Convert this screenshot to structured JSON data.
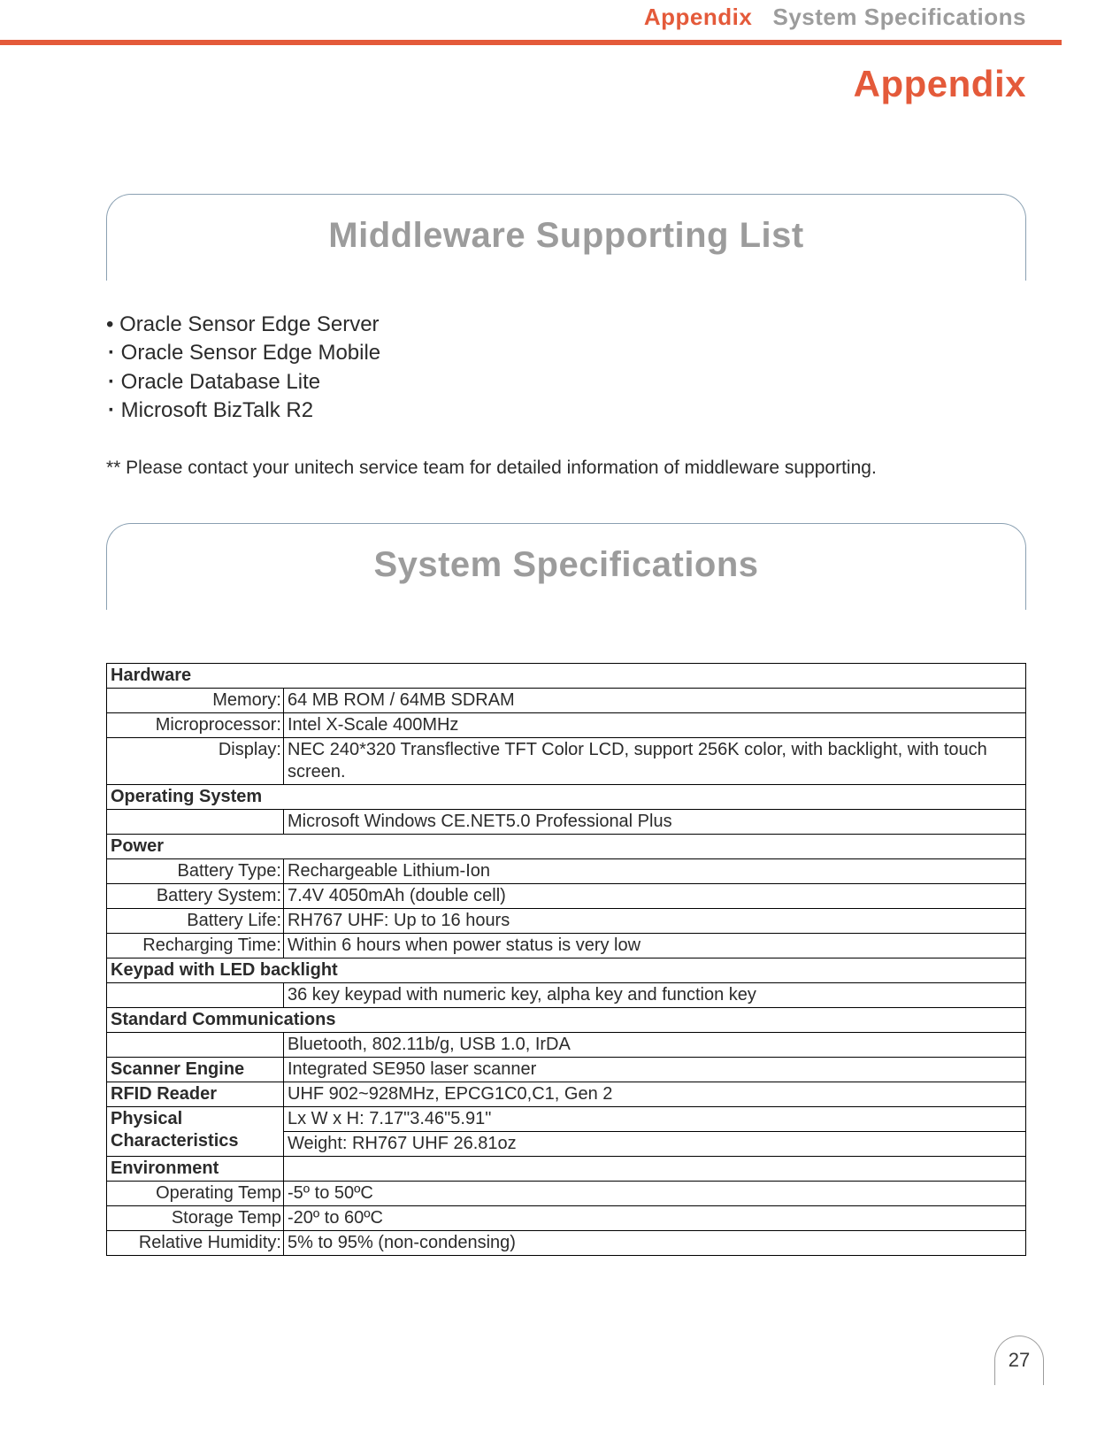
{
  "header": {
    "bc_accent": "Appendix",
    "bc_grey": "System Specifications"
  },
  "page_title": "Appendix",
  "middleware": {
    "banner": "Middleware Supporting List",
    "items": [
      "Oracle Sensor Edge Server",
      "Oracle Sensor Edge Mobile",
      "Oracle Database Lite",
      "Microsoft BizTalk R2"
    ],
    "footnote": "** Please contact your unitech service team for detailed information of middleware supporting."
  },
  "sysspec": {
    "banner": "System Specifications"
  },
  "spec": {
    "hardware_hdr": "Hardware",
    "memory_l": "Memory:",
    "memory_v": "64 MB ROM / 64MB SDRAM",
    "micro_l": "Microprocessor:",
    "micro_v": "Intel X-Scale 400MHz",
    "display_l": "Display:",
    "display_v": "NEC 240*320 Transflective TFT Color LCD, support 256K color, with backlight, with touch screen.",
    "os_hdr": "Operating System",
    "os_v": "Microsoft Windows CE.NET5.0 Professional Plus",
    "power_hdr": "Power",
    "bat_type_l": "Battery Type:",
    "bat_type_v": "Rechargeable Lithium-Ion",
    "bat_sys_l": "Battery System:",
    "bat_sys_v": "7.4V 4050mAh (double cell)",
    "bat_life_l": "Battery Life:",
    "bat_life_v": "RH767 UHF:   Up to 16 hours",
    "recharge_l": "Recharging Time:",
    "recharge_v": "Within 6 hours when power status is very low",
    "keypad_hdr": "Keypad with LED backlight",
    "keypad_v": "36 key keypad with numeric key, alpha key and function key",
    "comm_hdr": "Standard Communications",
    "comm_v": "Bluetooth, 802.11b/g, USB 1.0, IrDA",
    "scanner_hdr": "Scanner Engine",
    "scanner_v": "Integrated SE950 laser scanner",
    "rfid_hdr": "RFID Reader",
    "rfid_v": "UHF 902~928MHz, EPCG1C0,C1, Gen 2",
    "phys_hdr": "Physical Characteristics",
    "phys_dim": "Lx W x H: 7.17\"3.46\"5.91\"",
    "phys_wt": "Weight: RH767 UHF 26.81oz",
    "env_hdr": "Environment",
    "op_temp_l": "Operating Temp",
    "op_temp_v": "-5º to 50ºC",
    "st_temp_l": "Storage Temp",
    "st_temp_v": "-20º to 60ºC",
    "rh_l": "Relative Humidity:",
    "rh_v": "5% to 95% (non-condensing)"
  },
  "page_number": "27"
}
